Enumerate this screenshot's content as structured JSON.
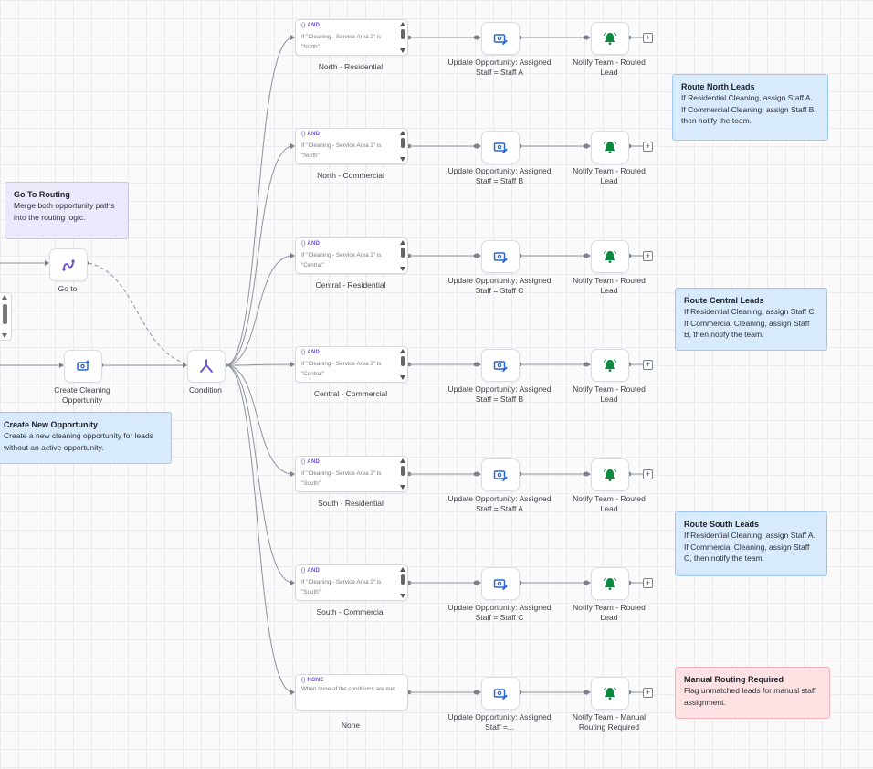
{
  "colors": {
    "accent": "#6c4bd8",
    "action_blue": "#2a67d6",
    "notify_green": "#0b8a3f",
    "wire": "#8e929b"
  },
  "notes": {
    "go_to_routing": {
      "title": "Go To Routing",
      "body": "Merge both opportunity paths into the routing logic."
    },
    "create_new_opportunity": {
      "title": "Create New Opportunity",
      "body": "Create a new cleaning opportunity for leads without an active opportunity."
    },
    "route_north": {
      "title": "Route North Leads",
      "body": "If Residential Cleaning, assign Staff A. If Commercial Cleaning, assign Staff B, then notify the team."
    },
    "route_central": {
      "title": "Route Central Leads",
      "body": "If Residential Cleaning, assign Staff C. If Commercial Cleaning, assign Staff B, then notify the team."
    },
    "route_south": {
      "title": "Route South Leads",
      "body": "If Residential Cleaning, assign Staff A. If Commercial Cleaning, assign Staff C, then notify the team."
    },
    "manual_routing": {
      "title": "Manual Routing Required",
      "body": "Flag unmatched leads for manual staff assignment."
    }
  },
  "nodes": {
    "goto": {
      "label": "Go to",
      "icon": "goto-route-icon"
    },
    "create": {
      "label": "Create Cleaning Opportunity",
      "icon": "opportunity-add-icon"
    },
    "condition": {
      "label": "Condition",
      "icon": "condition-split-icon"
    }
  },
  "branches": [
    {
      "badge": "AND",
      "condition": "If \"Cleaning - Service Area 2\" is \"North\"",
      "name": "North - Residential",
      "update_label": "Update Opportunity: Assigned Staff = Staff A",
      "notify_label": "Notify Team - Routed Lead"
    },
    {
      "badge": "AND",
      "condition": "If \"Cleaning - Service Area 2\" is \"North\"",
      "name": "North - Commercial",
      "update_label": "Update Opportunity: Assigned Staff = Staff B",
      "notify_label": "Notify Team - Routed Lead"
    },
    {
      "badge": "AND",
      "condition": "If \"Cleaning - Service Area 2\" is \"Central\"",
      "name": "Central - Residential",
      "update_label": "Update Opportunity: Assigned Staff = Staff C",
      "notify_label": "Notify Team - Routed Lead"
    },
    {
      "badge": "AND",
      "condition": "If \"Cleaning - Service Area 2\" is \"Central\"",
      "name": "Central - Commercial",
      "update_label": "Update Opportunity: Assigned Staff = Staff B",
      "notify_label": "Notify Team - Routed Lead"
    },
    {
      "badge": "AND",
      "condition": "If \"Cleaning - Service Area 2\" is \"South\"",
      "name": "South - Residential",
      "update_label": "Update Opportunity: Assigned Staff = Staff A",
      "notify_label": "Notify Team - Routed Lead"
    },
    {
      "badge": "AND",
      "condition": "If \"Cleaning - Service Area 2\" is \"South\"",
      "name": "South - Commercial",
      "update_label": "Update Opportunity: Assigned Staff = Staff C",
      "notify_label": "Notify Team - Routed Lead"
    },
    {
      "badge": "NONE",
      "condition": "When none of the conditions are met",
      "name": "None",
      "update_label": "Update Opportunity: Assigned Staff =...",
      "notify_label": "Notify Team - Manual Routing Required"
    }
  ]
}
